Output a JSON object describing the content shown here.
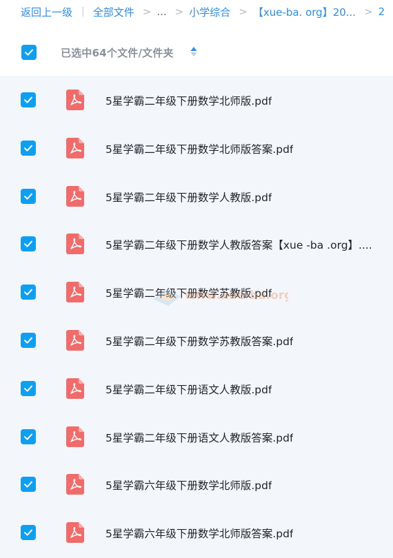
{
  "breadcrumb": {
    "back": "返回上一级",
    "all_files": "全部文件",
    "ellipsis": "...",
    "folder": "小学综合",
    "current": "【xue-ba. org】20...",
    "next_fragment": "2"
  },
  "toolbar": {
    "selected_text": "已选中64个文件/文件夹"
  },
  "colors": {
    "accent": "#0f9ff2",
    "link": "#2a8df0",
    "pdf_red": "#f16b6b",
    "list_bg": "#f3f7fc"
  },
  "files": [
    {
      "name": "5星学霸二年级下册数学北师版.pdf",
      "checked": true,
      "icon": "pdf-icon"
    },
    {
      "name": "5星学霸二年级下册数学北师版答案.pdf",
      "checked": true,
      "icon": "pdf-icon"
    },
    {
      "name": "5星学霸二年级下册数学人教版.pdf",
      "checked": true,
      "icon": "pdf-icon"
    },
    {
      "name": "5星学霸二年级下册数学人教版答案【xue -ba .org】....",
      "checked": true,
      "icon": "pdf-icon"
    },
    {
      "name": "5星学霸二年级下册数学苏教版.pdf",
      "checked": true,
      "icon": "pdf-icon"
    },
    {
      "name": "5星学霸二年级下册数学苏教版答案.pdf",
      "checked": true,
      "icon": "pdf-icon"
    },
    {
      "name": "5星学霸二年级下册语文人教版.pdf",
      "checked": true,
      "icon": "pdf-icon"
    },
    {
      "name": "5星学霸二年级下册语文人教版答案.pdf",
      "checked": true,
      "icon": "pdf-icon"
    },
    {
      "name": "5星学霸六年级下册数学北师版.pdf",
      "checked": true,
      "icon": "pdf-icon"
    },
    {
      "name": "5星学霸六年级下册数学北师版答案.pdf",
      "checked": true,
      "icon": "pdf-icon"
    }
  ],
  "watermark": {
    "text": "www.xue-ba.org"
  }
}
